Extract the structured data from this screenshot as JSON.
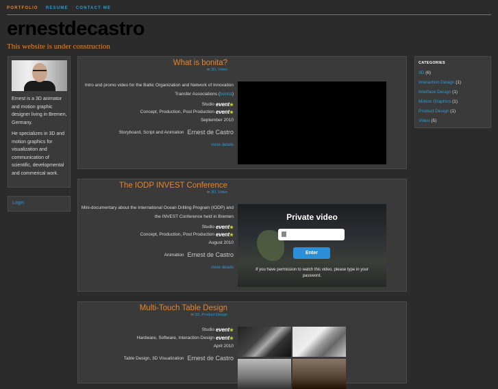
{
  "nav": {
    "items": [
      "PORTFOLIO",
      "RESUME",
      "CONTACT ME"
    ]
  },
  "site": {
    "title": "ernestdecastro",
    "subtitle": "This website is under construction"
  },
  "sidebar": {
    "bio": [
      "Ernest is a 3D animator and motion graphic designer living in Bremen, Germany.",
      "He specializes in 3D and motion graphics for visualization and communication of scientific, developmental and commerical work."
    ],
    "login_label": "Login"
  },
  "posts": [
    {
      "title": "What is bonita?",
      "category_prefix": "in",
      "category": "3D, Video",
      "description_pre": "Intro and promo video for the Baltic Organization and Network of Innovation Transfer Associations (",
      "description_link": "bonita",
      "description_post": ")",
      "studio_label": "Studio",
      "studio_logo": "event",
      "role_label": "Concept, Production, Post Production",
      "role_logo": "event",
      "date": "September 2010",
      "credit_label": "Storyboard, Script and Animation",
      "credit_name": "Ernest de Castro",
      "more_label": "more details"
    },
    {
      "title": "The IODP INVEST Conference",
      "category_prefix": "in",
      "category": "3D, Video",
      "description": "Mini-documentary about the International Ocean Drilling Program (IODP) and the INVEST Conference held in Bremen",
      "studio_label": "Studio",
      "studio_logo": "event",
      "role_label": "Concept, Production, Post Production",
      "role_logo": "event",
      "date": "August 2010",
      "credit_label": "Animation",
      "credit_name": "Ernest de Castro",
      "more_label": "more details",
      "video": {
        "title": "Private video",
        "password_value": "",
        "enter_label": "Enter",
        "note": "If you have permission to watch this video, please type in your password."
      }
    },
    {
      "title": "Multi-Touch Table Design",
      "category_prefix": "in",
      "category": "3D, Product Design",
      "studio_label": "Studio",
      "studio_logo": "event",
      "role_label": "Hardware, Software, Interaction Design",
      "role_logo": "event",
      "date": "April 2010",
      "credit_label": "Table Design, 3D Visualization",
      "credit_name": "Ernest de Castro"
    }
  ],
  "categories": {
    "title": "CATEGORIES",
    "items": [
      {
        "name": "3D",
        "count": "(6)"
      },
      {
        "name": "Interaction Design",
        "count": "(1)"
      },
      {
        "name": "Interface Design",
        "count": "(1)"
      },
      {
        "name": "Motion Graphics",
        "count": "(1)"
      },
      {
        "name": "Product Design",
        "count": "(1)"
      },
      {
        "name": "Video",
        "count": "(5)"
      }
    ]
  }
}
